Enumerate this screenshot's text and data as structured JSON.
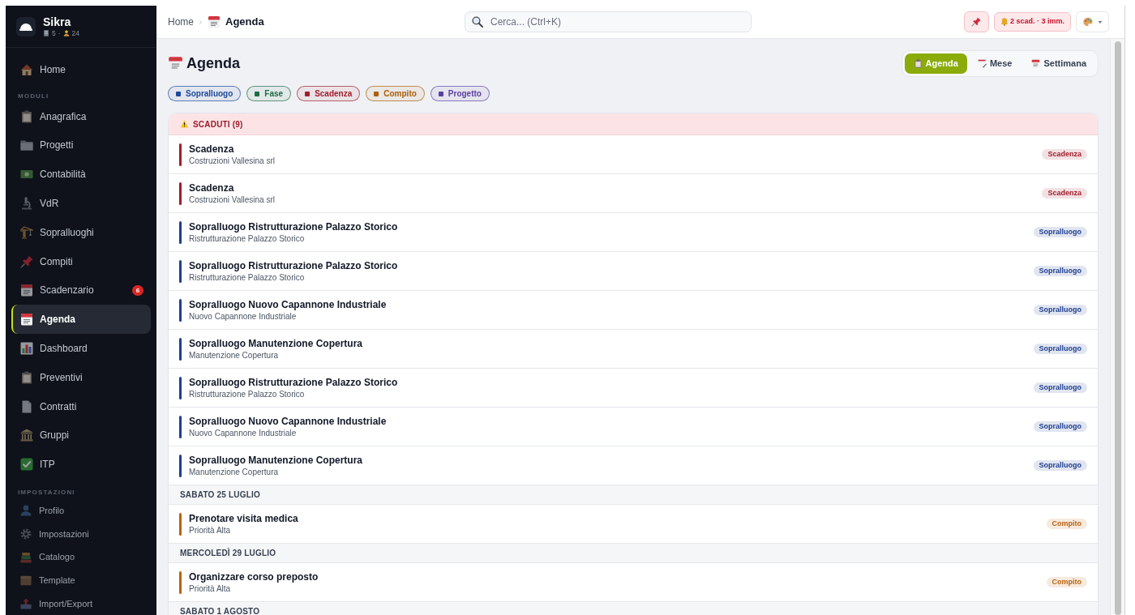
{
  "sidebar": {
    "brand": {
      "name": "Sikra",
      "stats": [
        "5",
        "24"
      ],
      "separator": "·"
    },
    "sections": [
      {
        "kind": "main",
        "items": [
          {
            "label": "Home",
            "selected": false
          }
        ]
      },
      {
        "kind": "main",
        "heading": "MODULI",
        "items": [
          {
            "label": "Anagrafica",
            "selected": false
          },
          {
            "label": "Progetti",
            "selected": false
          },
          {
            "label": "Contabilità",
            "selected": false
          },
          {
            "label": "VdR",
            "selected": false
          },
          {
            "label": "Sopralluoghi",
            "selected": false
          },
          {
            "label": "Compiti",
            "selected": false
          },
          {
            "label": "Scadenzario",
            "selected": false,
            "badge": "6"
          },
          {
            "label": "Agenda",
            "selected": true
          },
          {
            "label": "Dashboard",
            "selected": false
          },
          {
            "label": "Preventivi",
            "selected": false
          },
          {
            "label": "Contratti",
            "selected": false
          },
          {
            "label": "Gruppi",
            "selected": false
          },
          {
            "label": "ITP",
            "selected": false
          }
        ]
      },
      {
        "kind": "settings",
        "heading": "IMPOSTAZIONI",
        "items": [
          {
            "label": "Profilo",
            "selected": false
          },
          {
            "label": "Impostazioni",
            "selected": false
          },
          {
            "label": "Catalogo",
            "selected": false
          },
          {
            "label": "Template",
            "selected": false
          },
          {
            "label": "Import/Export",
            "selected": false
          }
        ]
      }
    ]
  },
  "topbar": {
    "breadcrumb": [
      {
        "label": "Home"
      },
      {
        "label": "Agenda"
      }
    ],
    "search": {
      "placeholder": "Cerca... (Ctrl+K)"
    },
    "alerts": "2 scad. · 3 imm."
  },
  "page": {
    "title": "Agenda",
    "views": [
      {
        "label": "Agenda",
        "selected": true
      },
      {
        "label": "Mese",
        "selected": false
      },
      {
        "label": "Settimana",
        "selected": false
      }
    ],
    "filters": [
      {
        "label": "Sopralluogo",
        "color": "#1e4a9a"
      },
      {
        "label": "Fase",
        "color": "#1f6b45"
      },
      {
        "label": "Scadenza",
        "color": "#a11d2b"
      },
      {
        "label": "Compito",
        "color": "#a8600c"
      },
      {
        "label": "Progetto",
        "color": "#5b3fa0"
      }
    ],
    "groups": [
      {
        "kind": "overdue",
        "heading": "SCADUTI (9)",
        "items": [
          {
            "title": "Scadenza",
            "subtitle": "Costruzioni Vallesina srl",
            "tag": "Scadenza",
            "color": "#a11d2b"
          },
          {
            "title": "Scadenza",
            "subtitle": "Costruzioni Vallesina srl",
            "tag": "Scadenza",
            "color": "#a11d2b"
          },
          {
            "title": "Sopralluogo Ristrutturazione Palazzo Storico",
            "subtitle": "Ristrutturazione Palazzo Storico",
            "tag": "Sopralluogo",
            "color": "#1e3f8f"
          },
          {
            "title": "Sopralluogo Ristrutturazione Palazzo Storico",
            "subtitle": "Ristrutturazione Palazzo Storico",
            "tag": "Sopralluogo",
            "color": "#1e3f8f"
          },
          {
            "title": "Sopralluogo Nuovo Capannone Industriale",
            "subtitle": "Nuovo Capannone Industriale",
            "tag": "Sopralluogo",
            "color": "#1e3f8f"
          },
          {
            "title": "Sopralluogo Manutenzione Copertura",
            "subtitle": "Manutenzione Copertura",
            "tag": "Sopralluogo",
            "color": "#1e3f8f"
          },
          {
            "title": "Sopralluogo Ristrutturazione Palazzo Storico",
            "subtitle": "Ristrutturazione Palazzo Storico",
            "tag": "Sopralluogo",
            "color": "#1e3f8f"
          },
          {
            "title": "Sopralluogo Nuovo Capannone Industriale",
            "subtitle": "Nuovo Capannone Industriale",
            "tag": "Sopralluogo",
            "color": "#1e3f8f"
          },
          {
            "title": "Sopralluogo Manutenzione Copertura",
            "subtitle": "Manutenzione Copertura",
            "tag": "Sopralluogo",
            "color": "#1e3f8f"
          }
        ]
      },
      {
        "kind": "day",
        "heading": "SABATO 25 LUGLIO",
        "items": [
          {
            "title": "Prenotare visita medica",
            "subtitle": "Priorità Alta",
            "tag": "Compito",
            "color": "#b8620e"
          }
        ]
      },
      {
        "kind": "day",
        "heading": "MERCOLEDÌ 29 LUGLIO",
        "items": [
          {
            "title": "Organizzare corso preposto",
            "subtitle": "Priorità Alta",
            "tag": "Compito",
            "color": "#b8620e"
          }
        ]
      },
      {
        "kind": "day",
        "heading": "SABATO 1 AGOSTO"
      }
    ]
  }
}
